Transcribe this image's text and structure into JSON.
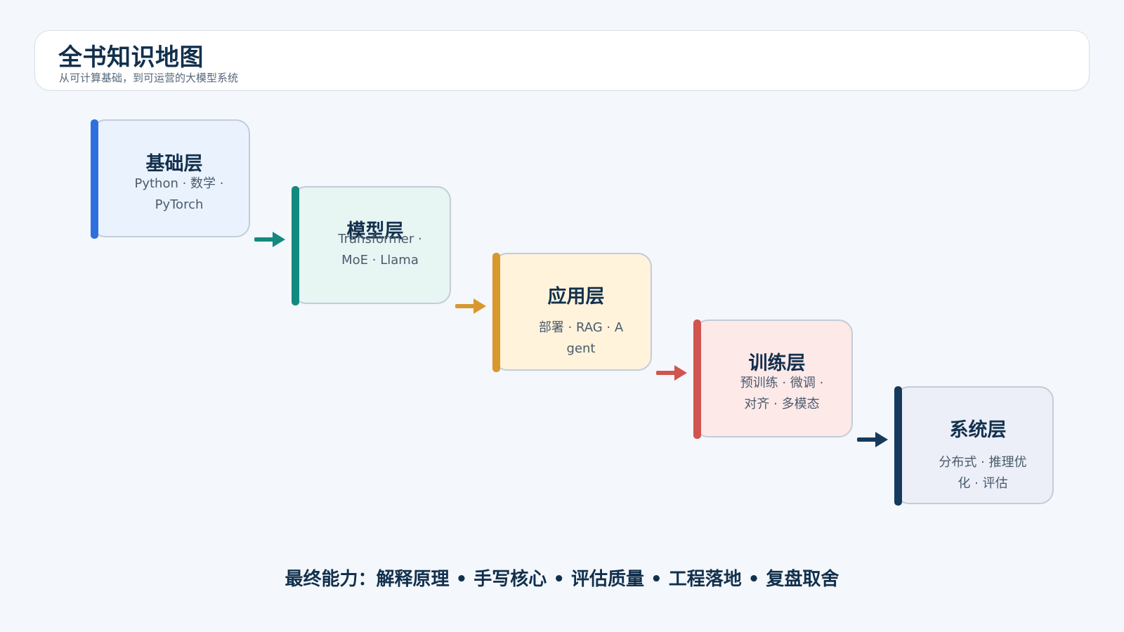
{
  "header": {
    "title": "全书知识地图",
    "subtitle": "从可计算基础，到可运营的大模型系统"
  },
  "layers": [
    {
      "title": "基础层",
      "description": "Python · 数学 · PyTorch",
      "accent_color": "#2f6fe0",
      "fill_color": "#eaf2fe"
    },
    {
      "title": "模型层",
      "description": "Transformer · MoE · Llama",
      "accent_color": "#138a80",
      "fill_color": "#e7f5f3"
    },
    {
      "title": "应用层",
      "description": "部署 · RAG · Agent",
      "accent_color": "#d9972d",
      "fill_color": "#fff3dc"
    },
    {
      "title": "训练层",
      "description": "预训练 · 微调 · 对齐 · 多模态",
      "accent_color": "#d05450",
      "fill_color": "#fde9e8"
    },
    {
      "title": "系统层",
      "description": "分布式 · 推理优化 · 评估",
      "accent_color": "#153a5c",
      "fill_color": "#eceff7"
    }
  ],
  "footer": {
    "text": "最终能力：解释原理 • 手写核心 • 评估质量 • 工程落地 • 复盘取舍"
  }
}
